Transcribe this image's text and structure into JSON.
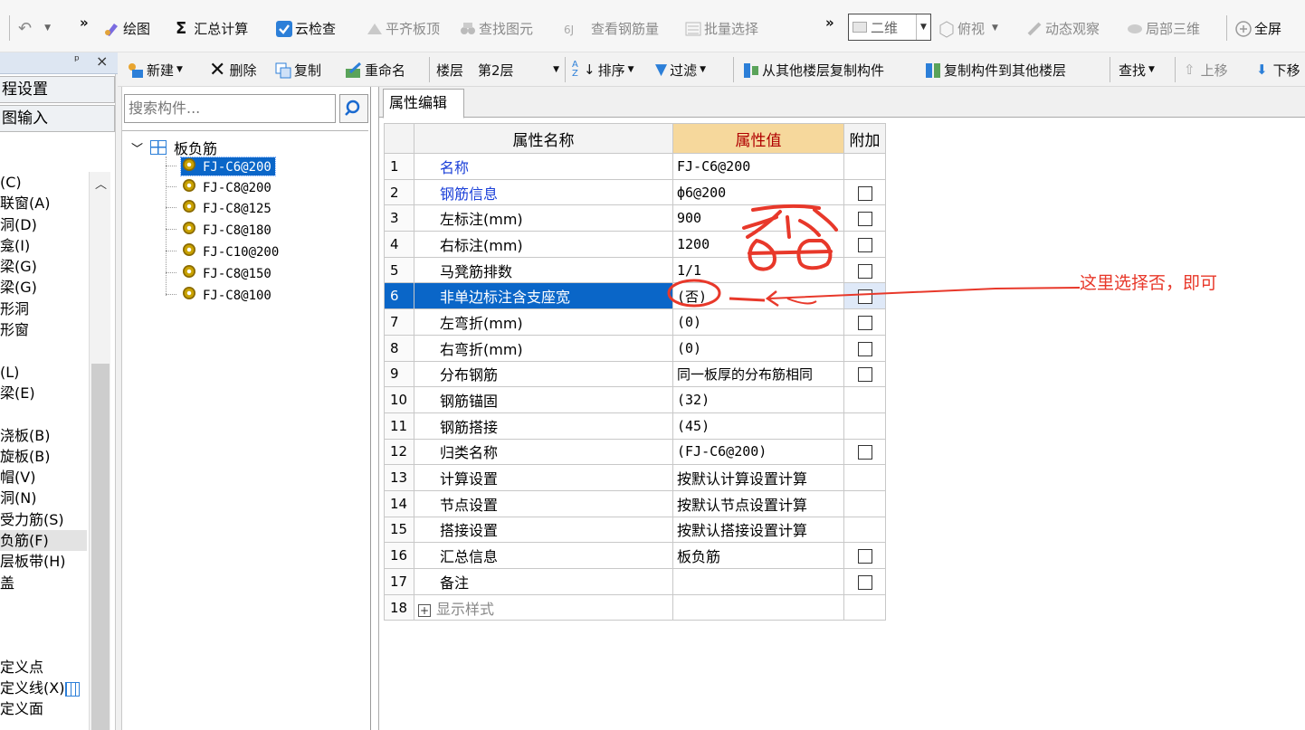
{
  "toolbar1": {
    "undo_glyph": "↶",
    "more_glyph": "»",
    "draw": "绘图",
    "sum_calc": "汇总计算",
    "cloud_check": "云检查",
    "align_top": "平齐板顶",
    "find_elem": "查找图元",
    "view_rebar": "查看钢筋量",
    "batch_select": "批量选择",
    "view_mode": "二维",
    "top_view": "俯视",
    "orbit": "动态观察",
    "local_3d": "局部三维",
    "fullscreen": "全屏"
  },
  "toolbar2": {
    "new": "新建",
    "delete": "删除",
    "copy": "复制",
    "rename": "重命名",
    "floor_label": "楼层",
    "floor_value": "第2层",
    "sort": "排序",
    "filter": "过滤",
    "copy_from_floor": "从其他楼层复制构件",
    "copy_to_floor": "复制构件到其他楼层",
    "find": "查找",
    "move_up": "上移",
    "move_down": "下移"
  },
  "left_panel": {
    "pin": "ᵖ",
    "close": "×",
    "tabs": [
      "程设置",
      "图输入"
    ],
    "items": [
      "(C)",
      "联窗(A)",
      "洞(D)",
      "龛(I)",
      "梁(G)",
      "梁(G)",
      "形洞",
      "形窗",
      "",
      "(L)",
      "梁(E)",
      "",
      "浇板(B)",
      "旋板(B)",
      "帽(V)",
      "洞(N)",
      "受力筋(S)",
      "负筋(F)",
      "层板带(H)",
      "盖",
      "",
      "",
      "",
      "定义点",
      "定义线(X)",
      "定义面"
    ]
  },
  "tree": {
    "search_placeholder": "搜索构件...",
    "root": "板负筋",
    "nodes": [
      "FJ-C6@200",
      "FJ-C8@200",
      "FJ-C8@125",
      "FJ-C8@180",
      "FJ-C10@200",
      "FJ-C8@150",
      "FJ-C8@100"
    ]
  },
  "props": {
    "tab": "属性编辑",
    "headers": {
      "name": "属性名称",
      "value": "属性值",
      "extra": "附加"
    },
    "rows": [
      {
        "no": "1",
        "name": "名称",
        "value": "FJ-C6@200"
      },
      {
        "no": "2",
        "name": "钢筋信息",
        "value": "ф6@200"
      },
      {
        "no": "3",
        "name": "左标注(mm)",
        "value": "900"
      },
      {
        "no": "4",
        "name": "右标注(mm)",
        "value": "1200"
      },
      {
        "no": "5",
        "name": "马凳筋排数",
        "value": "1/1"
      },
      {
        "no": "6",
        "name": "非单边标注含支座宽",
        "value": "(否)"
      },
      {
        "no": "7",
        "name": "左弯折(mm)",
        "value": "(0)"
      },
      {
        "no": "8",
        "name": "右弯折(mm)",
        "value": "(0)"
      },
      {
        "no": "9",
        "name": "分布钢筋",
        "value": "同一板厚的分布筋相同"
      },
      {
        "no": "10",
        "name": "钢筋锚固",
        "value": "(32)"
      },
      {
        "no": "11",
        "name": "钢筋搭接",
        "value": "(45)"
      },
      {
        "no": "12",
        "name": "归类名称",
        "value": "(FJ-C6@200)"
      },
      {
        "no": "13",
        "name": "计算设置",
        "value": "按默认计算设置计算"
      },
      {
        "no": "14",
        "name": "节点设置",
        "value": "按默认节点设置计算"
      },
      {
        "no": "15",
        "name": "搭接设置",
        "value": "按默认搭接设置计算"
      },
      {
        "no": "16",
        "name": "汇总信息",
        "value": "板负筋"
      },
      {
        "no": "17",
        "name": "备注",
        "value": ""
      },
      {
        "no": "18",
        "name": "显示样式",
        "value": ""
      }
    ]
  },
  "annotation": {
    "note": "这里选择否，即可",
    "handwritten": "否",
    "color": "#e8382a"
  },
  "colors": {
    "selection_blue": "#0a66c8",
    "header_value_bg": "#f6d89c",
    "link_blue": "#1a3fd8"
  }
}
